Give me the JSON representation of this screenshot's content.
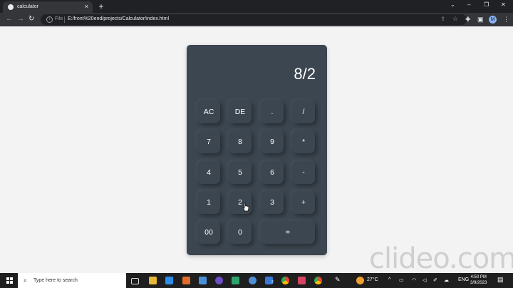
{
  "browser": {
    "tab_title": "calculator",
    "tab_close": "×",
    "new_tab": "+",
    "url_protocol": "File",
    "url": "E:/front%20end/projects/Calculator/index.html",
    "avatar_initial": "M"
  },
  "calculator": {
    "display": "8/2",
    "buttons": [
      "AC",
      "DE",
      ".",
      "/",
      "7",
      "8",
      "9",
      "*",
      "4",
      "5",
      "6",
      "-",
      "1",
      "2",
      "3",
      "+",
      "00",
      "0",
      "="
    ]
  },
  "watermark": "clideo.com",
  "taskbar": {
    "search_placeholder": "Type here to search",
    "temperature": "27°C",
    "language": "ENG",
    "time": "4:50 PM",
    "date": "3/9/2023",
    "badge_count": "2",
    "icons": [
      "task-view-icon",
      "file-explorer-icon",
      "vscode-icon",
      "app-orange-icon",
      "app-blue-icon",
      "app-purple-icon",
      "app-green-icon",
      "app-blue-r-icon",
      "app-checkmark-icon",
      "chrome-icon",
      "app-red-icon",
      "chrome-icon-2",
      "pen-icon",
      "weather-icon"
    ]
  },
  "colors": {
    "calc_bg": "#3c4650",
    "page_bg": "#f3f3f3",
    "chrome_dark": "#202124",
    "chrome_toolbar": "#35363a"
  }
}
